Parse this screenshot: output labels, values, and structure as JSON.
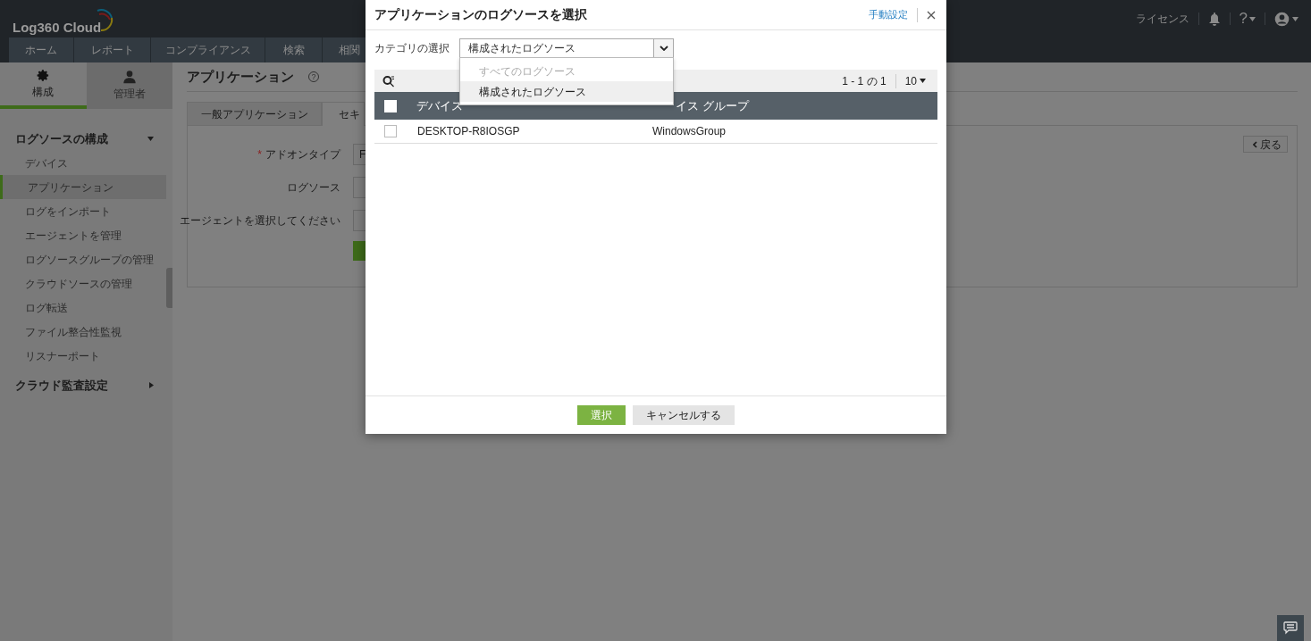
{
  "header": {
    "logo": "Log360 Cloud",
    "license_link": "ライセンス",
    "help": "?"
  },
  "nav_tabs": [
    "ホーム",
    "レポート",
    "コンプライアンス",
    "検索",
    "相関"
  ],
  "sidebar": {
    "tabs": [
      {
        "label": "構成",
        "kind": "gear",
        "selected": true
      },
      {
        "label": "管理者",
        "kind": "user",
        "selected": false
      }
    ],
    "sections": [
      {
        "title": "ログソースの構成",
        "expanded": true,
        "items": [
          {
            "label": "デバイス",
            "selected": false
          },
          {
            "label": "アプリケーション",
            "selected": true
          },
          {
            "label": "ログをインポート",
            "selected": false
          },
          {
            "label": "エージェントを管理",
            "selected": false
          },
          {
            "label": "ログソースグループの管理",
            "selected": false
          },
          {
            "label": "クラウドソースの管理",
            "selected": false
          },
          {
            "label": "ログ転送",
            "selected": false
          },
          {
            "label": "ファイル整合性監視",
            "selected": false
          },
          {
            "label": "リスナーポート",
            "selected": false
          }
        ]
      },
      {
        "title": "クラウド監査設定",
        "expanded": false
      }
    ]
  },
  "page": {
    "title": "アプリケーション",
    "tabs": [
      {
        "label": "一般アプリケーション",
        "selected": false
      },
      {
        "label": "セキ",
        "selected": true
      }
    ],
    "form": [
      {
        "label": "アドオンタイプ",
        "required_mark": "*",
        "value": "F"
      },
      {
        "label": "ログソース"
      },
      {
        "label": "エージェントを選択してください"
      }
    ],
    "back_button": "戻る"
  },
  "modal": {
    "title": "アプリケーションのログソースを選択",
    "manual_link": "手動設定",
    "category_label": "カテゴリの選択",
    "category_value": "構成されたログソース",
    "category_options": [
      {
        "label": "すべてのログソース",
        "disabled": true,
        "selected": false
      },
      {
        "label": "構成されたログソース",
        "disabled": false,
        "selected": true
      }
    ],
    "pagination": "1 - 1 の 1",
    "page_size": "10",
    "select_all_checked": false,
    "columns": [
      "デバイス",
      "イス グループ"
    ],
    "rows": [
      {
        "checked": false,
        "cells": [
          "DESKTOP-R8IOSGP",
          "WindowsGroup"
        ]
      }
    ],
    "buttons": [
      {
        "label": "選択",
        "kind": "primary"
      },
      {
        "label": "キャンセルする",
        "kind": "secondary"
      }
    ]
  }
}
